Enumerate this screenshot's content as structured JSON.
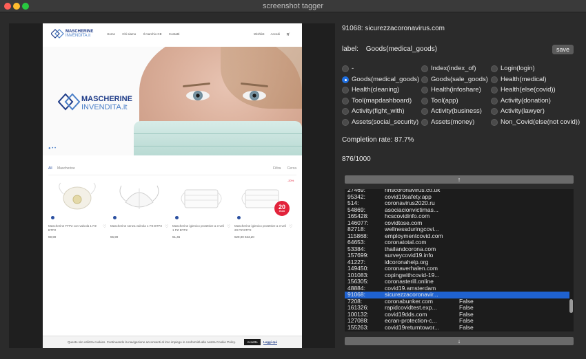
{
  "window": {
    "title": "screenshot tagger"
  },
  "preview": {
    "nav_links": [
      "Home",
      "Chi siamo",
      "Il marchio CE",
      "Contatti"
    ],
    "nav_right": [
      "Wishlist",
      "Accedi"
    ],
    "logo_line1": "MASCHERINE",
    "logo_line2": "INVENDITA.it",
    "filter_left": [
      "All",
      "Mascherine"
    ],
    "filter_right": [
      "Filtra",
      "Cerca"
    ],
    "products": [
      {
        "name": "Mascherine FFP2 con valvola 1 PZ BTP2",
        "price": "€9,90"
      },
      {
        "name": "Mascherine senza valvola 1 PZ BTP2",
        "price": "€6,90"
      },
      {
        "name": "Mascherine igienico protettive a 3 veli 1 PZ BTP2",
        "price": "€1,45"
      },
      {
        "name": "Mascherine igienico protettive a 3 veli 20 PZ BTP2",
        "price": "€29,00 €23,20"
      }
    ],
    "badge_value": "20",
    "badge_unit": "PEZZI",
    "sale_tag": "-20%",
    "cookie_text": "Questo sito utilizza cookies. Continuando la navigazione acconsenti al loro impiego in conformità alla nostra Cookie Policy.",
    "cookie_accept": "Accetto",
    "cookie_link": "Leggi qui"
  },
  "tagger": {
    "current": "91068: sicurezzacoronavirus.com",
    "label_caption": "label:",
    "label_value": "Goods(medical_goods)",
    "save_label": "save",
    "options": [
      {
        "label": "-",
        "selected": false
      },
      {
        "label": "Index(index_of)",
        "selected": false
      },
      {
        "label": "Login(login)",
        "selected": false
      },
      {
        "label": "Goods(medical_goods)",
        "selected": true
      },
      {
        "label": "Goods(sale_goods)",
        "selected": false
      },
      {
        "label": "Health(medical)",
        "selected": false
      },
      {
        "label": "Health(cleaning)",
        "selected": false
      },
      {
        "label": "Health(infoshare)",
        "selected": false
      },
      {
        "label": "Health(else(covid))",
        "selected": false
      },
      {
        "label": "Tool(mapdashboard)",
        "selected": false
      },
      {
        "label": "Tool(app)",
        "selected": false
      },
      {
        "label": "Activity(donation)",
        "selected": false
      },
      {
        "label": "Activity(fight_with)",
        "selected": false
      },
      {
        "label": "Activity(business)",
        "selected": false
      },
      {
        "label": "Activity(lawyer)",
        "selected": false
      },
      {
        "label": "Assets(social_security)",
        "selected": false
      },
      {
        "label": "Assets(money)",
        "selected": false
      },
      {
        "label": "Non_Covid(else(not covid))",
        "selected": false
      }
    ],
    "completion": "Completion rate: 87.7%",
    "counter": "876/1000",
    "up_arrow": "↑",
    "down_arrow": "↓",
    "rows": [
      {
        "id": "27469:",
        "domain": "nhscoronavirus.co.uk",
        "flag": ""
      },
      {
        "id": "95342:",
        "domain": "covid19safety.app",
        "flag": ""
      },
      {
        "id": "514:",
        "domain": "coronavirus2020.ru",
        "flag": ""
      },
      {
        "id": "54869:",
        "domain": "asociacionvictimas...",
        "flag": ""
      },
      {
        "id": "165428:",
        "domain": "hcscovidinfo.com",
        "flag": ""
      },
      {
        "id": "146077:",
        "domain": "covidtose.com",
        "flag": ""
      },
      {
        "id": "82718:",
        "domain": "wellnessduringcovi...",
        "flag": ""
      },
      {
        "id": "115868:",
        "domain": "employmentcovid.com",
        "flag": ""
      },
      {
        "id": "64653:",
        "domain": "coronatotal.com",
        "flag": ""
      },
      {
        "id": "53384:",
        "domain": "thailandcorona.com",
        "flag": ""
      },
      {
        "id": "157699:",
        "domain": "surveycovid19.info",
        "flag": ""
      },
      {
        "id": "41227:",
        "domain": "idcoronahelp.org",
        "flag": ""
      },
      {
        "id": "149450:",
        "domain": "coronaverhalen.com",
        "flag": ""
      },
      {
        "id": "101083:",
        "domain": "copingwithcovid-19...",
        "flag": ""
      },
      {
        "id": "156305:",
        "domain": "coronasterill.online",
        "flag": ""
      },
      {
        "id": "48884:",
        "domain": "covid19.amsterdam",
        "flag": ""
      },
      {
        "id": "91068:",
        "domain": "sicurezzacoronavir...",
        "flag": ""
      },
      {
        "id": "7208:",
        "domain": "coronabunker.com",
        "flag": "False"
      },
      {
        "id": "161326:",
        "domain": "rapidcovidtest.exp...",
        "flag": "False"
      },
      {
        "id": "100132:",
        "domain": "covid19dds.com",
        "flag": "False"
      },
      {
        "id": "127088:",
        "domain": "ecran-protection-c...",
        "flag": "False"
      },
      {
        "id": "155263:",
        "domain": "covid19returntowor...",
        "flag": "False"
      }
    ],
    "selected_row": "91068:",
    "colors": {
      "selection": "#1f62d0",
      "radio_selected": "#1f6fe0",
      "panel": "#2b2b2b"
    }
  }
}
